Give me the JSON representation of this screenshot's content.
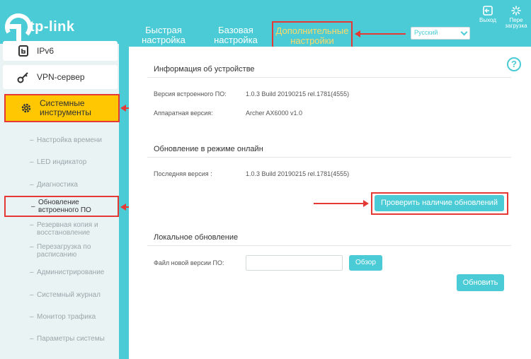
{
  "header": {
    "logo_text": "tp-link",
    "tabs": [
      {
        "label": "Быстрая настройка"
      },
      {
        "label": "Базовая настройка"
      },
      {
        "label": "Дополнительные настройки"
      }
    ],
    "language": "Русский",
    "logout_label": "Выход",
    "reboot_label": "Пере загрузка"
  },
  "sidebar": {
    "main_items": [
      {
        "label": "IPv6",
        "icon": "ipv6-icon"
      },
      {
        "label": "VPN-сервер",
        "icon": "vpn-key-icon"
      },
      {
        "label": "Системные инструменты",
        "icon": "gear-icon"
      }
    ],
    "sub_items": [
      {
        "label": "Настройка времени"
      },
      {
        "label": "LED индикатор"
      },
      {
        "label": "Диагностика"
      },
      {
        "label": "Обновление встроенного ПО"
      },
      {
        "label": "Резервная копия и восстановление"
      },
      {
        "label": "Перезагрузка по расписанию"
      },
      {
        "label": "Администрирование"
      },
      {
        "label": "Системный журнал"
      },
      {
        "label": "Монитор трафика"
      },
      {
        "label": "Параметры системы"
      }
    ]
  },
  "main": {
    "device_info": {
      "title": "Информация об устройстве",
      "firmware_label": "Версия встроенного ПО:",
      "firmware_value": "1.0.3 Build 20190215 rel.1781(4555)",
      "hardware_label": "Аппаратная версия:",
      "hardware_value": "Archer AX6000 v1.0"
    },
    "online_update": {
      "title": "Обновление в режиме онлайн",
      "latest_label": "Последняя версия :",
      "latest_value": "1.0.3 Build 20190215 rel.1781(4555)",
      "check_button": "Проверить наличие обновлений"
    },
    "local_update": {
      "title": "Локальное обновление",
      "file_label": "Файл новой версии ПО:",
      "file_value": "",
      "browse_button": "Обзор",
      "update_button": "Обновить"
    }
  },
  "colors": {
    "accent": "#4acbd6",
    "active_highlight": "#fec701",
    "annotation_red": "#e53935"
  }
}
